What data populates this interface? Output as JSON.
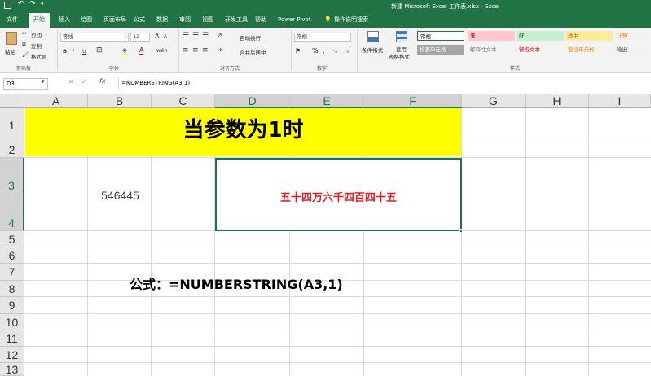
{
  "titlebar": {
    "document_title": "新建 Microsoft Excel 工作表.xlsx  -  Excel"
  },
  "tabs": [
    "文件",
    "开始",
    "插入",
    "绘图",
    "页面布局",
    "公式",
    "数据",
    "审阅",
    "视图",
    "开发工具",
    "帮助",
    "Power Pivot"
  ],
  "tell_me": "操作说明搜索",
  "ribbon": {
    "clipboard": {
      "paste": "粘贴",
      "cut": "剪切",
      "copy": "复制",
      "format_painter": "格式刷",
      "label": "剪贴板"
    },
    "font": {
      "name": "等线",
      "size": "12",
      "bold": "B",
      "italic": "I",
      "underline": "U",
      "font_color_letter": "A",
      "grow": "A",
      "shrink": "A",
      "label": "字体",
      "wen": "wén"
    },
    "alignment": {
      "wrap_text": "自动换行",
      "merge_center": "合并后居中",
      "label": "对齐方式"
    },
    "number": {
      "format": "常规",
      "percent": "%",
      "comma": ",",
      "label": "数字"
    },
    "styles": {
      "conditional": "条件格式",
      "table_format": "套用\n表格格式",
      "table_format_line1": "套用",
      "table_format_line2": "表格格式",
      "label": "样式",
      "cells": [
        {
          "text": "常规",
          "bg": "#ffffff",
          "fg": "#000000"
        },
        {
          "text": "差",
          "bg": "#ffc7ce",
          "fg": "#9c0006"
        },
        {
          "text": "好",
          "bg": "#c6efce",
          "fg": "#006100"
        },
        {
          "text": "适中",
          "bg": "#ffeb9c",
          "fg": "#9c5700"
        },
        {
          "text": "计算",
          "bg": "#f2f2f2",
          "fg": "#fa7d00"
        },
        {
          "text": "检查单元格",
          "bg": "#a5a5a5",
          "fg": "#ffffff"
        },
        {
          "text": "解释性文本",
          "bg": "#f3f3f3",
          "fg": "#7f7f7f"
        },
        {
          "text": "警告文本",
          "bg": "#f3f3f3",
          "fg": "#ff0000"
        },
        {
          "text": "链接单元格",
          "bg": "#f3f3f3",
          "fg": "#fa7d00"
        },
        {
          "text": "输出",
          "bg": "#f2f2f2",
          "fg": "#3f3f3f"
        }
      ]
    }
  },
  "formula_bar": {
    "name_box": "D3",
    "fx": "fx",
    "formula": "=NUMBERSTRING(A3,1)"
  },
  "columns": [
    "A",
    "B",
    "C",
    "D",
    "E",
    "F",
    "G",
    "H",
    "I"
  ],
  "rows": [
    "1",
    "2",
    "3",
    "4",
    "5",
    "6",
    "7",
    "8",
    "9",
    "10",
    "11",
    "12",
    "13"
  ],
  "sheet": {
    "title": "当参数为1时",
    "number_value": "546445",
    "result_value": "五十四万六千四百四十五",
    "formula_label": "公式：=NUMBERSTRING(A3,1)"
  },
  "colors": {
    "excel_green": "#217346",
    "title_fill": "#ffff00",
    "result_text": "#e02020"
  }
}
